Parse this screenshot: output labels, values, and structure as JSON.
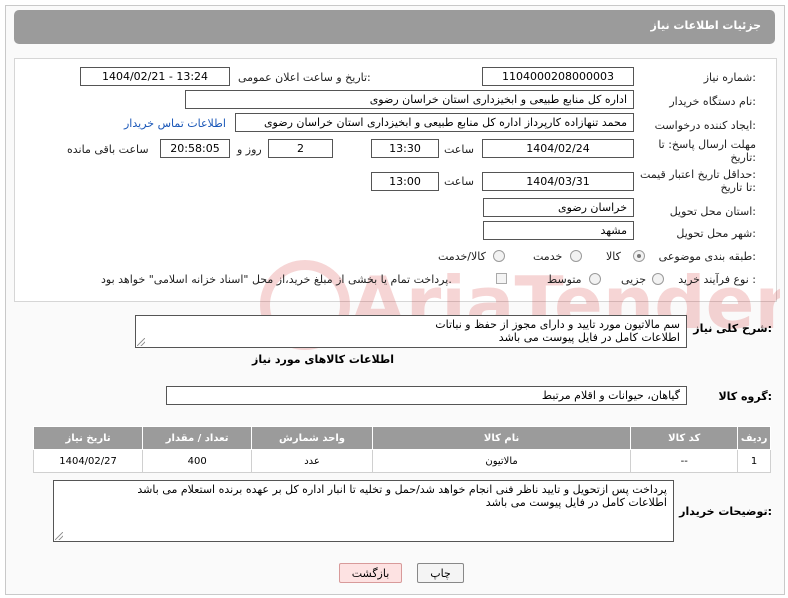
{
  "header": {
    "title": "جزئیات اطلاعات نیاز"
  },
  "fields": {
    "need_number_label": "شماره نیاز:",
    "need_number": "1104000208000003",
    "announce_label": "تاریخ و ساعت اعلان عمومی:",
    "announce_value": "1404/02/21 - 13:24",
    "buyer_org_label": "نام دستگاه خریدار:",
    "buyer_org": "اداره کل منابع طبیعی و ابخیزداری استان خراسان رضوی",
    "creator_label": "ایجاد کننده درخواست:",
    "creator": "محمد تنهازاده کارپرداز اداره کل منابع طبیعی و ابخیزداری استان خراسان رضوی",
    "contact_link": "اطلاعات تماس خریدار",
    "deadline_label_1": "مهلت ارسال پاسخ: تا",
    "deadline_label_2": "تاریخ:",
    "deadline_date": "1404/02/24",
    "time_label": "ساعت",
    "deadline_time": "13:30",
    "days_value": "2",
    "days_label": "روز و",
    "remaining_time": "20:58:05",
    "remaining_label": "ساعت باقی مانده",
    "validity_label_1": "حداقل تاریخ اعتبار قیمت:",
    "validity_label_2": "تا تاریخ:",
    "validity_date": "1404/03/31",
    "validity_time": "13:00",
    "province_label": "استان محل تحویل:",
    "province": "خراسان رضوی",
    "city_label": "شهر محل تحویل:",
    "city": "مشهد",
    "category_label": "طبقه بندی موضوعی:",
    "category_options": [
      "کالا",
      "خدمت",
      "کالا/خدمت"
    ],
    "category_selected": "کالا",
    "process_label": "نوع فرآیند خرید :",
    "process_options": [
      "جزیی",
      "متوسط"
    ],
    "payment_note": "پرداخت تمام یا بخشی از مبلغ خرید،از محل \"اسناد خزانه اسلامی\" خواهد بود."
  },
  "description": {
    "label": "شرح کلی نیاز:",
    "line1": "سم مالاتیون مورد تایید و دارای مجوز از حفظ و نباتات",
    "line2": "اطلاعات کامل در فایل پیوست می باشد"
  },
  "goods": {
    "section_title": "اطلاعات کالاهای مورد نیاز",
    "group_label": "گروه کالا:",
    "group_value": "گیاهان، حیوانات و اقلام مرتبط",
    "columns": [
      "ردیف",
      "کد کالا",
      "نام کالا",
      "واحد شمارش",
      "تعداد / مقدار",
      "تاریخ نیاز"
    ],
    "rows": [
      {
        "row": "1",
        "code": "--",
        "name": "مالاتیون",
        "unit": "عدد",
        "qty": "400",
        "date": "1404/02/27"
      }
    ]
  },
  "buyer_notes": {
    "label": "توضیحات خریدار:",
    "line1": "پرداخت پس ازتحویل و تایید ناظر فنی انجام خواهد شد/حمل و تخلیه تا انبار اداره کل بر عهده برنده استعلام می باشد",
    "line2": "اطلاعات کامل در فایل پیوست می باشد"
  },
  "buttons": {
    "print": "چاپ",
    "back": "بازگشت"
  },
  "watermark": {
    "text": "AriaTender.neT"
  },
  "colors": {
    "header_bg": "#9b9b9b",
    "link": "#1a57b8",
    "watermark": "#d01c1c"
  }
}
